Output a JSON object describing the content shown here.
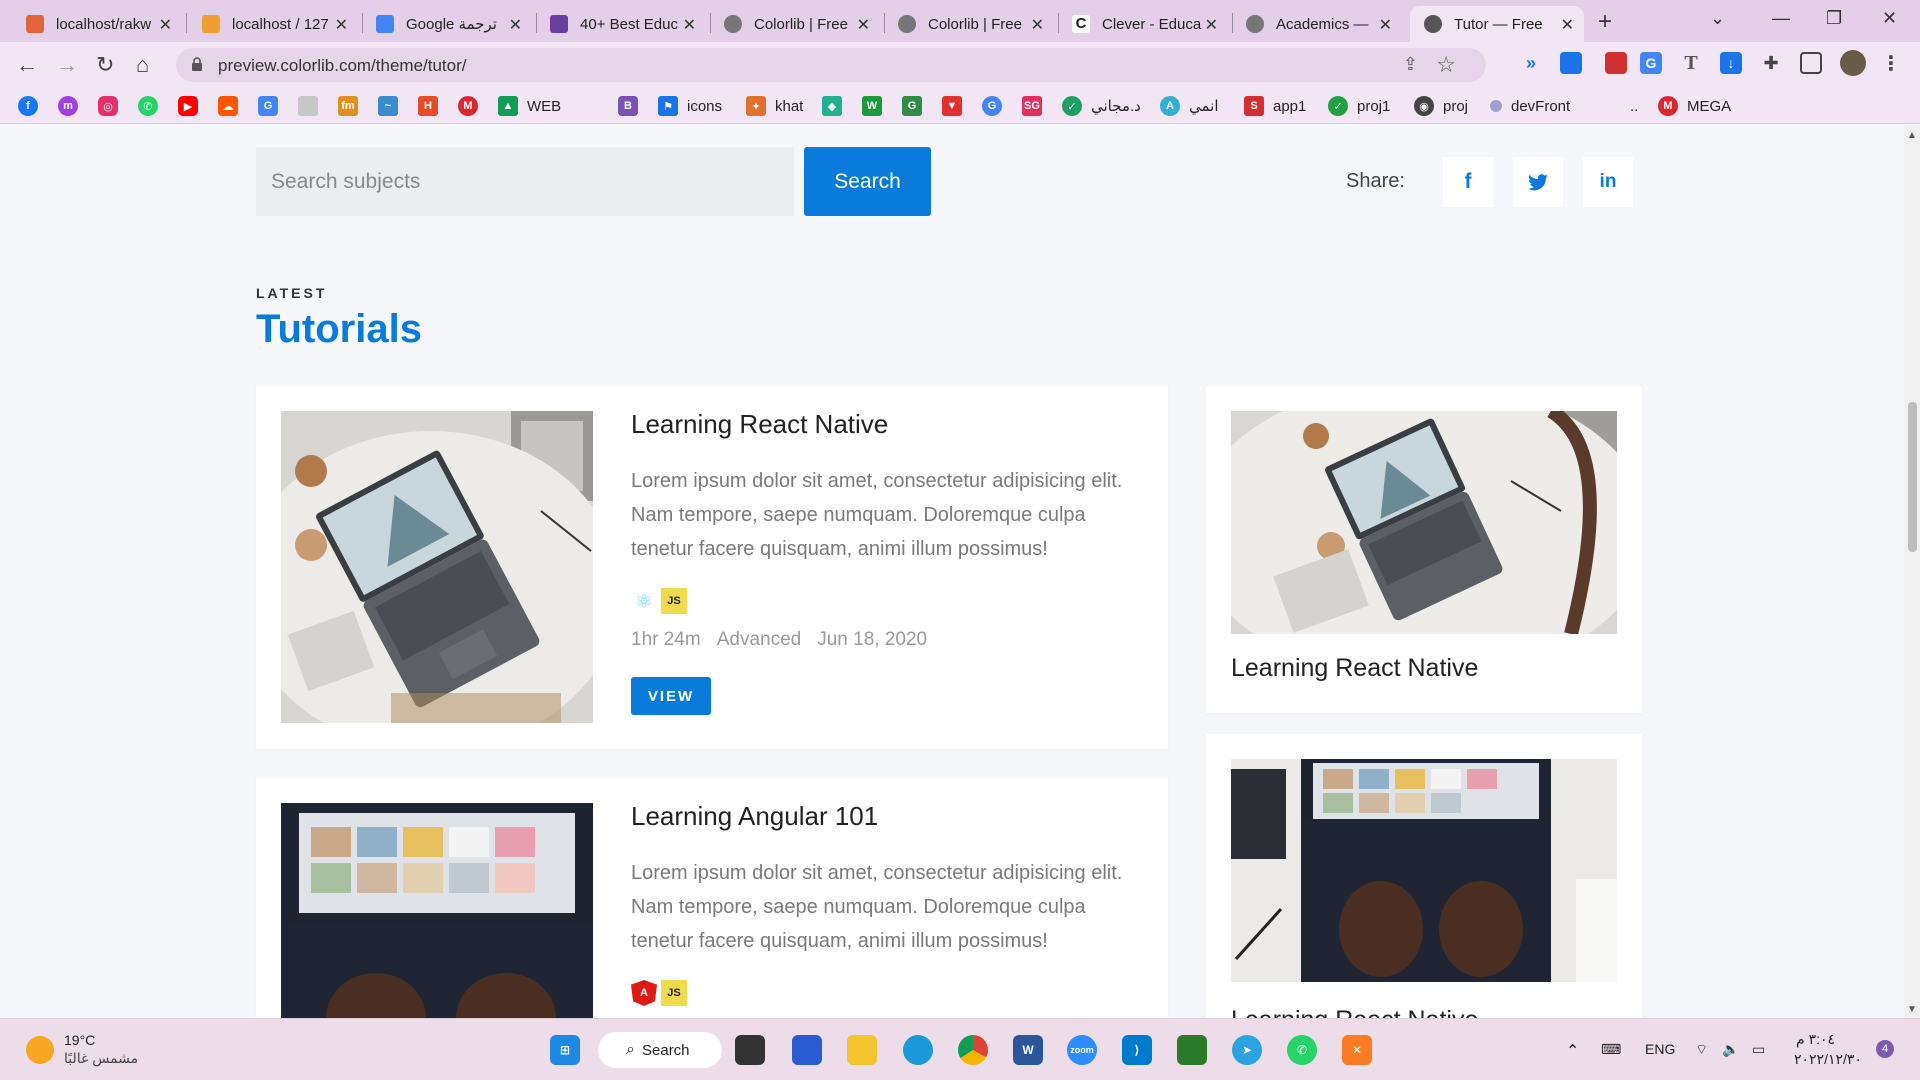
{
  "browser": {
    "tabs": [
      {
        "title": "localhost/rakw",
        "favicon_color": "#e2643c"
      },
      {
        "title": "localhost / 127",
        "favicon_color": "#f0a030"
      },
      {
        "title": "Google ترجمة",
        "favicon_color": "#4285f4"
      },
      {
        "title": "40+ Best Educ",
        "favicon_color": "#6a3fa0"
      },
      {
        "title": "Colorlib | Free",
        "favicon_color": "#777777"
      },
      {
        "title": "Colorlib | Free",
        "favicon_color": "#777777"
      },
      {
        "title": "Clever - Educa",
        "favicon_color": "#222222"
      },
      {
        "title": "Academics —",
        "favicon_color": "#777777"
      },
      {
        "title": "Tutor — Free",
        "favicon_color": "#555555",
        "active": true
      }
    ],
    "url": "preview.colorlib.com/theme/tutor/",
    "bookmarks": [
      {
        "label": "",
        "icon": "facebook-icon",
        "color": "#1877f2"
      },
      {
        "label": "",
        "icon": "messenger-icon",
        "color": "#a040e0"
      },
      {
        "label": "",
        "icon": "instagram-icon",
        "color": "#e1306c"
      },
      {
        "label": "",
        "icon": "whatsapp-icon",
        "color": "#25d366"
      },
      {
        "label": "",
        "icon": "youtube-icon",
        "color": "#ff0000"
      },
      {
        "label": "",
        "icon": "soundcloud-icon",
        "color": "#ff5500"
      },
      {
        "label": "",
        "icon": "translate-icon",
        "color": "#4285f4"
      },
      {
        "label": "",
        "icon": "bookmark-icon",
        "color": "#999999"
      },
      {
        "label": "",
        "icon": "fm-icon",
        "color": "#e09020"
      },
      {
        "label": "",
        "icon": "wave-icon",
        "color": "#3a8ad0"
      },
      {
        "label": "",
        "icon": "html-icon",
        "color": "#e44d26"
      },
      {
        "label": "",
        "icon": "mega-red-icon",
        "color": "#d9272e"
      },
      {
        "label": "WEB",
        "icon": "drive-icon",
        "color": "#0f9d58"
      },
      {
        "label": "",
        "icon": "bootstrap-icon",
        "color": "#7952b3"
      },
      {
        "label": "icons",
        "icon": "flag-icon",
        "color": "#1a73e8"
      },
      {
        "label": "khat",
        "icon": "khat-icon",
        "color": "#e07030"
      },
      {
        "label": "",
        "icon": "diamond-icon",
        "color": "#20b090"
      },
      {
        "label": "",
        "icon": "w-icon",
        "color": "#1a9a3a"
      },
      {
        "label": "",
        "icon": "gfg-icon",
        "color": "#2f8d46"
      },
      {
        "label": "",
        "icon": "vector-icon",
        "color": "#e03030"
      },
      {
        "label": "",
        "icon": "google-icon",
        "color": "#4285f4"
      },
      {
        "label": "",
        "icon": "sg-icon",
        "color": "#e03060"
      },
      {
        "label": "د.مجاني",
        "icon": "shield-check-icon",
        "color": "#20a060"
      },
      {
        "label": "انمي",
        "icon": "anime-icon",
        "color": "#30b0d0"
      },
      {
        "label": "app1",
        "icon": "s-icon",
        "color": "#d03030"
      },
      {
        "label": "proj1",
        "icon": "check-circle-icon",
        "color": "#20a040"
      },
      {
        "label": "proj",
        "icon": "globe-icon",
        "color": "#444444"
      },
      {
        "label": "devFront",
        "icon": "dev-icon",
        "color": "#a0a0d0"
      },
      {
        "label": "..",
        "icon": "",
        "color": ""
      },
      {
        "label": "MEGA",
        "icon": "mega-icon",
        "color": "#d9272e"
      }
    ]
  },
  "page": {
    "search": {
      "placeholder": "Search subjects",
      "button": "Search"
    },
    "share_label": "Share:",
    "share_icons": [
      "f",
      "t",
      "in"
    ],
    "section": {
      "eyebrow": "LATEST",
      "title": "Tutorials"
    },
    "main_cards": [
      {
        "title": "Learning React Native",
        "description": "Lorem ipsum dolor sit amet, consectetur adipisicing elit. Nam tempore, saepe numquam. Doloremque culpa tenetur facere quisquam, animi illum possimus!",
        "tech": [
          "React",
          "JS"
        ],
        "duration": "1hr 24m",
        "level": "Advanced",
        "date": "Jun 18, 2020",
        "button": "VIEW"
      },
      {
        "title": "Learning Angular 101",
        "description": "Lorem ipsum dolor sit amet, consectetur adipisicing elit. Nam tempore, saepe numquam. Doloremque culpa tenetur facere quisquam, animi illum possimus!",
        "tech": [
          "Angular",
          "JS"
        ]
      }
    ],
    "side_cards": [
      {
        "title": "Learning React Native"
      },
      {
        "title": "Learning React Native"
      }
    ]
  },
  "taskbar": {
    "weather_temp": "19°C",
    "weather_text": "مشمس غالبًا",
    "search_label": "Search",
    "language": "ENG",
    "time": "٣:٠٤ م",
    "date": "٢٠٢٢/١٢/٣٠",
    "notifications": "4"
  }
}
